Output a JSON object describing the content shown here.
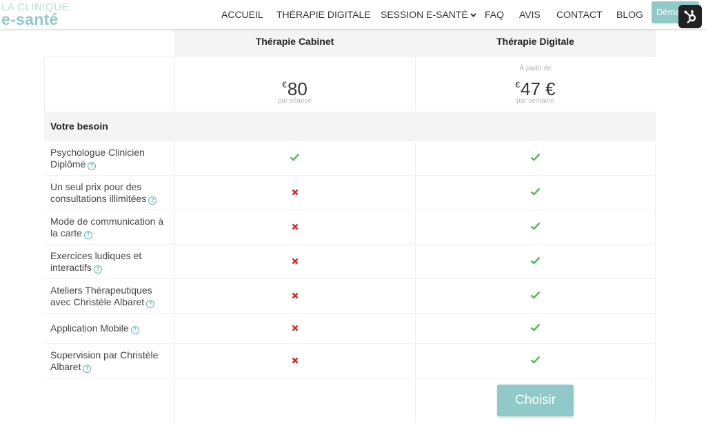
{
  "logo": {
    "line1": "LA CLINIQUE",
    "line2": "e-santé"
  },
  "nav": {
    "items": [
      {
        "label": "ACCUEIL"
      },
      {
        "label": "THÉRAPIE DIGITALE"
      },
      {
        "label": "SESSION E-SANTÉ",
        "has_dropdown": true
      },
      {
        "label": "FAQ"
      },
      {
        "label": "AVIS"
      },
      {
        "label": "CONTACT"
      },
      {
        "label": "BLOG"
      }
    ],
    "cta_label": "Déma"
  },
  "hubspot_icon": "hubspot-sprocket-icon",
  "table": {
    "columns": [
      {
        "name": "Thérapie Cabinet",
        "price_prefix": "",
        "currency": "€",
        "price": "80",
        "price_period": "par séance"
      },
      {
        "name": "Thérapie Digitale",
        "price_prefix": "À partir de",
        "currency": "€",
        "price": "47 €",
        "price_period": "par semaine"
      }
    ],
    "section_title": "Votre besoin",
    "features": [
      {
        "label": "Psychologue Clinicien Diplômé",
        "cabinet": true,
        "digitale": true
      },
      {
        "label": "Un seul prix pour des consultations illimitées",
        "cabinet": false,
        "digitale": true
      },
      {
        "label": "Mode de communication à la carte",
        "cabinet": false,
        "digitale": true
      },
      {
        "label": "Exercices ludiques et interactifs",
        "cabinet": false,
        "digitale": true
      },
      {
        "label": "Ateliers Thérapeutiques avec Christèle Albaret",
        "cabinet": false,
        "digitale": true
      },
      {
        "label": "Application Mobile",
        "cabinet": false,
        "digitale": true
      },
      {
        "label": "Supervision par Christèle Albaret",
        "cabinet": false,
        "digitale": true
      }
    ],
    "choose_label": "Choisir"
  },
  "colors": {
    "accent": "#8fcac9",
    "check": "#5cb85c",
    "cross": "#d9232d",
    "help": "#5bb5b3"
  }
}
